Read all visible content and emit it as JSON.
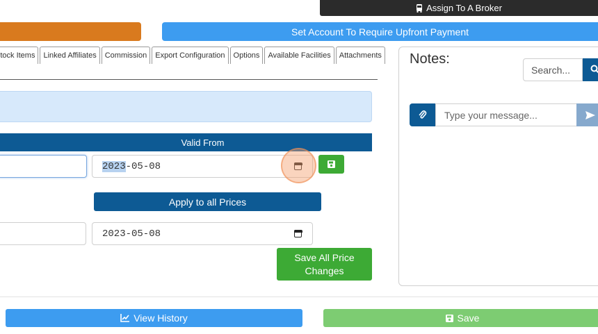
{
  "top": {
    "assign_broker_label": "Assign To A Broker",
    "upfront_payment_label": "Set Account To Require Upfront Payment"
  },
  "tabs": [
    {
      "label": "Stock Items"
    },
    {
      "label": "Linked Affiliates"
    },
    {
      "label": "Commission"
    },
    {
      "label": "Export Configuration"
    },
    {
      "label": "Options"
    },
    {
      "label": "Available Facilities"
    },
    {
      "label": "Attachments"
    }
  ],
  "pricing": {
    "valid_from_header": "Valid From",
    "row1": {
      "date_selected_part": "2023",
      "date_rest": "-05-08"
    },
    "apply_all_label": "Apply to all Prices",
    "row2": {
      "date_value": "2023-05-08"
    },
    "save_all_label_line1": "Save All Price",
    "save_all_label_line2": "Changes"
  },
  "notes": {
    "title": "Notes:",
    "search_placeholder": "Search...",
    "message_placeholder": "Type your message..."
  },
  "footer": {
    "view_history_label": "View History",
    "save_label": "Save"
  },
  "colors": {
    "primary_dark": "#0d5a94",
    "primary_light": "#3d9cf0",
    "success": "#3daa35",
    "success_light": "#7dcc72",
    "orange": "#d97a1e"
  }
}
